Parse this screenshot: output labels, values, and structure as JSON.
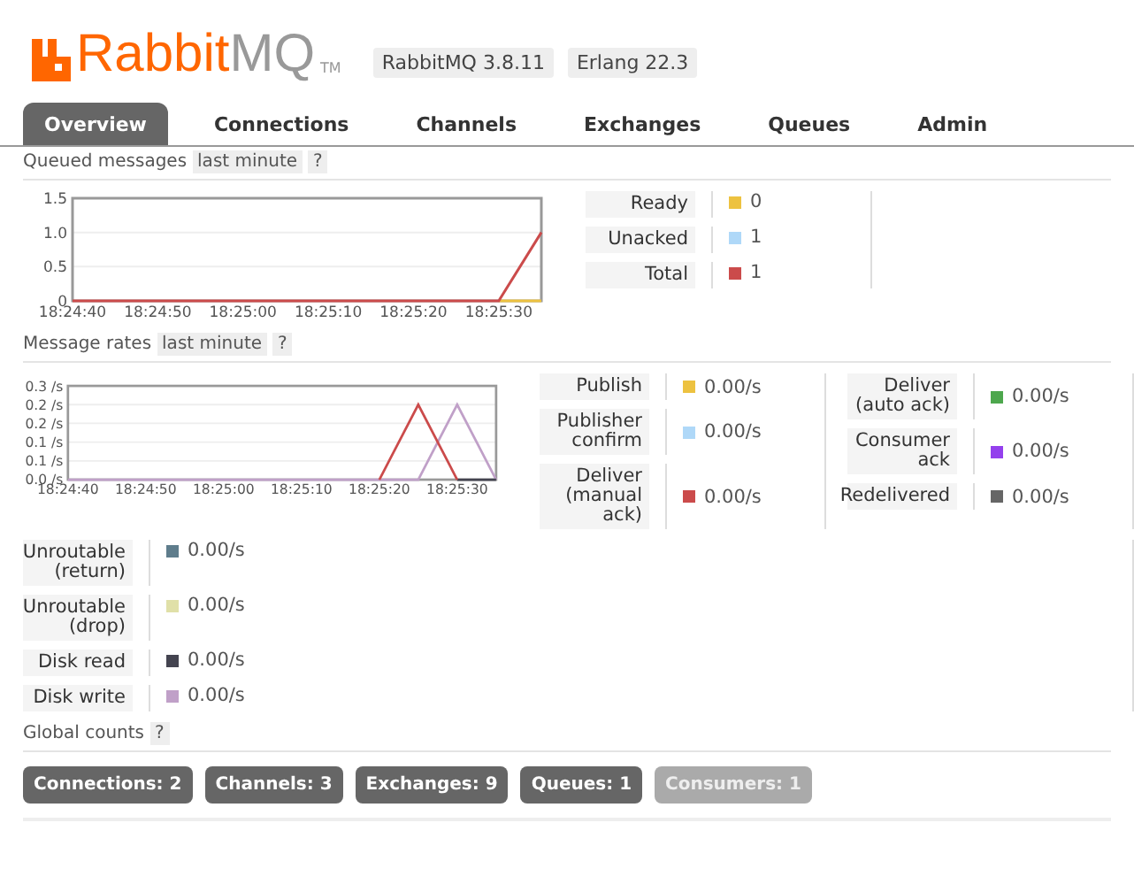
{
  "header": {
    "brand_primary": "Rabbit",
    "brand_secondary": "MQ",
    "trademark": "TM",
    "badges": [
      "RabbitMQ 3.8.11",
      "Erlang 22.3"
    ]
  },
  "tabs": [
    {
      "label": "Overview",
      "selected": true
    },
    {
      "label": "Connections",
      "selected": false
    },
    {
      "label": "Channels",
      "selected": false
    },
    {
      "label": "Exchanges",
      "selected": false
    },
    {
      "label": "Queues",
      "selected": false
    },
    {
      "label": "Admin",
      "selected": false
    }
  ],
  "queued": {
    "title": "Queued messages",
    "range": "last minute",
    "help": "?",
    "chart_data": {
      "type": "line",
      "categories": [
        "18:24:40",
        null,
        "18:24:50",
        null,
        "18:25:00",
        null,
        "18:25:10",
        null,
        "18:25:20",
        null,
        "18:25:30",
        null
      ],
      "ylim": [
        0,
        1.5
      ],
      "yticks": [
        0,
        {
          "value": 0.5,
          "label": "0.5"
        },
        {
          "value": 1,
          "label": "1.0"
        },
        1.5
      ],
      "grid": true,
      "series": [
        {
          "color": "#edc240",
          "values": [
            null,
            null,
            null,
            null,
            null,
            null,
            null,
            null,
            null,
            null,
            0,
            0
          ]
        },
        {
          "color": "#cb4b4b",
          "values": [
            0,
            0,
            0,
            0,
            0,
            0,
            0,
            0,
            0,
            0,
            0,
            1
          ]
        }
      ]
    },
    "legend": [
      {
        "label": "Ready",
        "color": "#edc240",
        "value": "0"
      },
      {
        "label": "Unacked",
        "color": "#afd8f8",
        "value": "1"
      },
      {
        "label": "Total",
        "color": "#cb4b4b",
        "value": "1"
      }
    ]
  },
  "rates": {
    "title": "Message rates",
    "range": "last minute",
    "help": "?",
    "chart_data": {
      "type": "line",
      "categories": [
        "18:24:40",
        null,
        "18:24:50",
        null,
        "18:25:00",
        null,
        "18:25:10",
        null,
        "18:25:20",
        null,
        "18:25:30",
        null
      ],
      "ylim": [
        0,
        0.25
      ],
      "yticks": [
        {
          "value": 0,
          "label": "0.0 /s"
        },
        {
          "value": 0.05,
          "label": "0.1 /s"
        },
        {
          "value": 0.1,
          "label": "0.1 /s"
        },
        {
          "value": 0.15,
          "label": "0.2 /s"
        },
        {
          "value": 0.2,
          "label": "0.2 /s"
        },
        {
          "value": 0.25,
          "label": "0.3 /s"
        }
      ],
      "grid": true,
      "series": [
        {
          "color": "#c0a0c8",
          "values": [
            0,
            0,
            0,
            0,
            0,
            0,
            0,
            0,
            0,
            0,
            0.2,
            0
          ]
        },
        {
          "color": "#444450",
          "values": [
            null,
            null,
            null,
            null,
            null,
            null,
            null,
            null,
            null,
            null,
            0,
            0
          ]
        },
        {
          "color": "#cb4b4b",
          "values": [
            null,
            null,
            null,
            null,
            null,
            null,
            null,
            null,
            0,
            0.2,
            0,
            null
          ]
        }
      ]
    },
    "legend_columns": [
      [
        {
          "label": "Publish",
          "color": "#edc240",
          "value": "0.00/s"
        },
        {
          "label": "Publisher\nconfirm",
          "color": "#afd8f8",
          "value": "0.00/s"
        },
        {
          "label": "Deliver\n(manual\nack)",
          "color": "#cb4b4b",
          "value": "0.00/s"
        }
      ],
      [
        {
          "label": "Deliver\n(auto ack)",
          "color": "#4da74d",
          "value": "0.00/s"
        },
        {
          "label": "Consumer\nack",
          "color": "#9440ed",
          "value": "0.00/s"
        },
        {
          "label": "Redelivered",
          "color": "#666666",
          "value": "0.00/s"
        }
      ]
    ],
    "legend_more": [
      {
        "label": "Unroutable\n(return)",
        "color": "#5f7d8c",
        "value": "0.00/s"
      },
      {
        "label": "Unroutable\n(drop)",
        "color": "#e0e0a8",
        "value": "0.00/s"
      },
      {
        "label": "Disk read",
        "color": "#444450",
        "value": "0.00/s"
      },
      {
        "label": "Disk write",
        "color": "#c0a0c8",
        "value": "0.00/s"
      }
    ]
  },
  "global_counts": {
    "title": "Global counts",
    "help": "?",
    "items": [
      {
        "label": "Connections: 2",
        "disabled": false
      },
      {
        "label": "Channels: 3",
        "disabled": false
      },
      {
        "label": "Exchanges: 9",
        "disabled": false
      },
      {
        "label": "Queues: 1",
        "disabled": false
      },
      {
        "label": "Consumers: 1",
        "disabled": true
      }
    ]
  }
}
